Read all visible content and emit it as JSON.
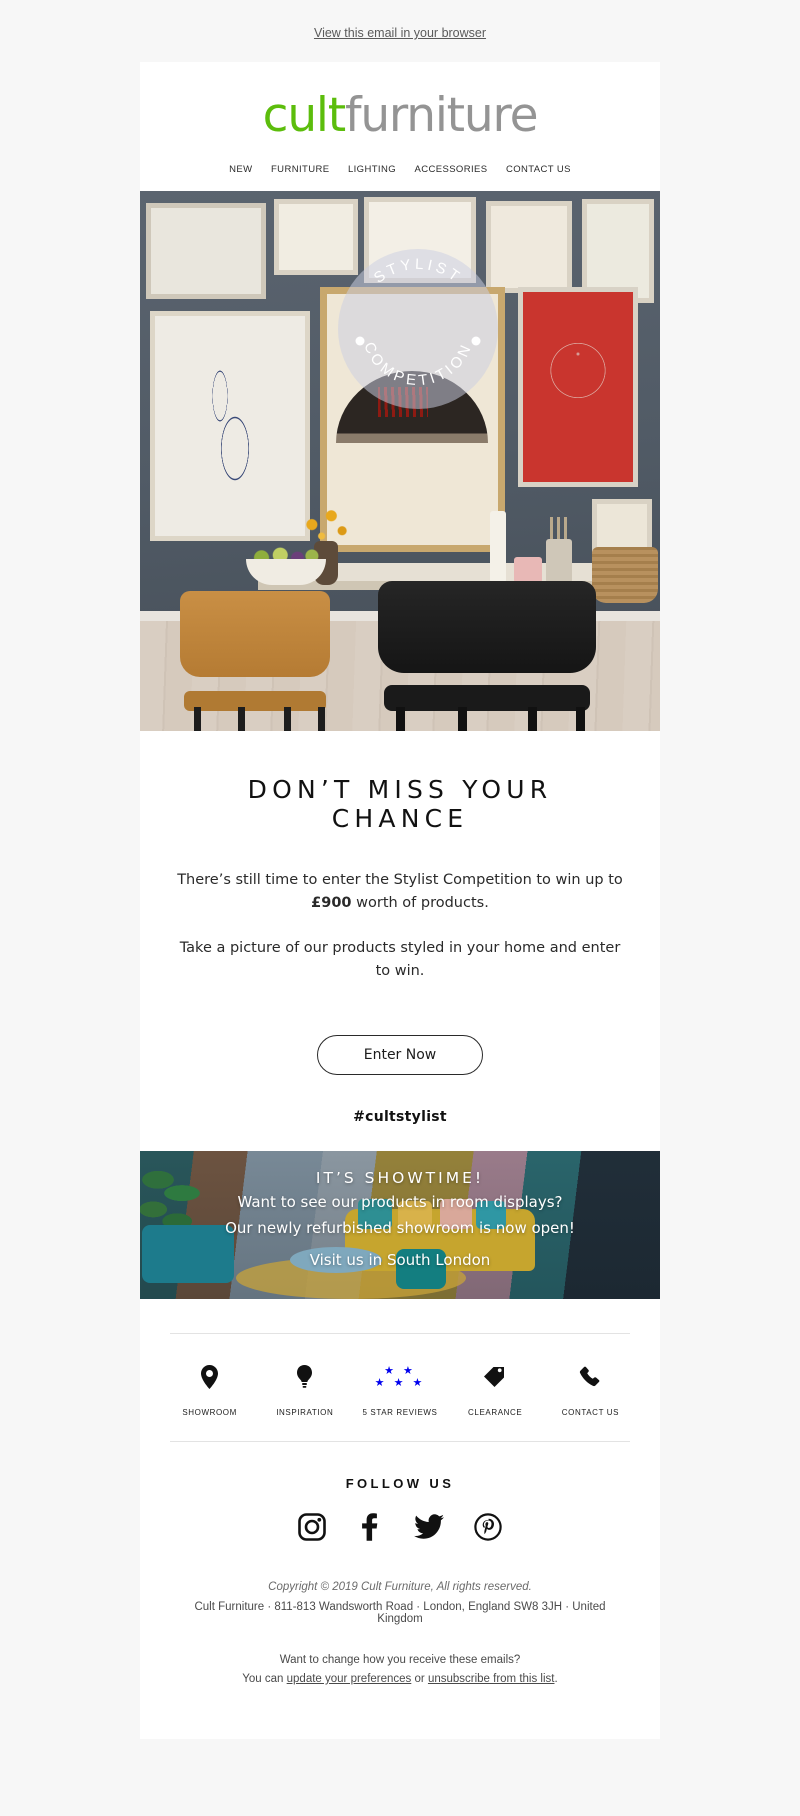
{
  "preheader": {
    "view_in_browser": "View this email in your browser"
  },
  "header": {
    "logo": {
      "part1": "cult",
      "part2": "furniture",
      "green": "#5cbd0c",
      "grey": "#949494"
    },
    "nav": [
      {
        "label": "NEW"
      },
      {
        "label": "FURNITURE"
      },
      {
        "label": "LIGHTING"
      },
      {
        "label": "ACCESSORIES"
      },
      {
        "label": "CONTACT US"
      }
    ]
  },
  "hero": {
    "badge": {
      "top_text": "STYLIST",
      "bottom_text": "COMPETITION"
    }
  },
  "message": {
    "headline": "DON’T MISS YOUR CHANCE",
    "para1_before": "There’s still time to enter the Stylist Competition to win up to ",
    "para1_bold": "£900",
    "para1_after": " worth of products.",
    "para2": "Take a picture of our products styled in your home and enter to win.",
    "cta_label": "Enter Now",
    "hashtag": "#cultstylist"
  },
  "banner": {
    "title": "IT’S SHOWTIME!",
    "line1": "Want to see our products in room displays?",
    "line2": "Our newly refurbished showroom is now open!",
    "line3": "Visit us in South London"
  },
  "services": [
    {
      "icon": "map-pin-icon",
      "label": "SHOWROOM"
    },
    {
      "icon": "lightbulb-icon",
      "label": "INSPIRATION"
    },
    {
      "icon": "stars-icon",
      "label": "5 STAR REVIEWS",
      "row1": "★ ★",
      "row2": "★ ★ ★"
    },
    {
      "icon": "tag-icon",
      "label": "CLEARANCE"
    },
    {
      "icon": "phone-icon",
      "label": "CONTACT US"
    }
  ],
  "follow": {
    "title": "FOLLOW US",
    "socials": [
      {
        "icon": "instagram-icon",
        "name": "Instagram"
      },
      {
        "icon": "facebook-icon",
        "name": "Facebook"
      },
      {
        "icon": "twitter-icon",
        "name": "Twitter"
      },
      {
        "icon": "pinterest-icon",
        "name": "Pinterest"
      }
    ]
  },
  "footer": {
    "copyright": "Copyright © 2019 Cult Furniture, All rights reserved.",
    "address": "Cult Furniture · 811-813 Wandsworth Road · London, England SW8 3JH · United Kingdom",
    "prefs_question": "Want to change how you receive these emails?",
    "prefs_prefix": "You can ",
    "prefs_link1": "update your preferences",
    "prefs_middle": " or ",
    "prefs_link2": "unsubscribe from this list",
    "prefs_suffix": "."
  }
}
